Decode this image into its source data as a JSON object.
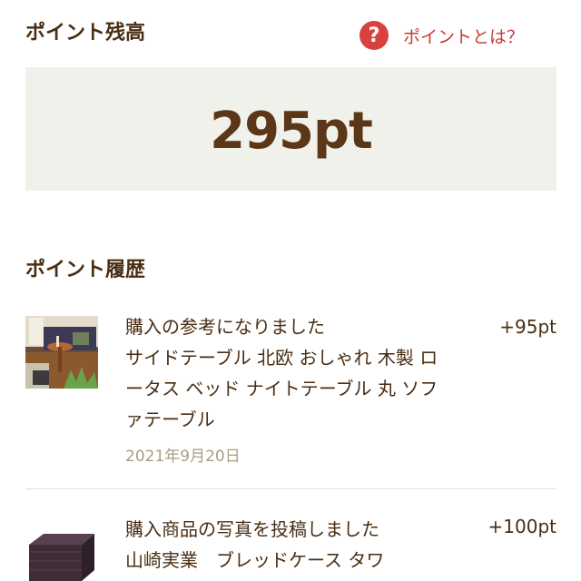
{
  "balance": {
    "title": "ポイント残高",
    "help_label": "ポイントとは？",
    "help_icon": "?",
    "value": "295pt"
  },
  "history": {
    "title": "ポイント履歴",
    "items": [
      {
        "reason": "購入の参考になりました",
        "product": "サイドテーブル 北欧 おしゃれ 木製 ロータス ベッド ナイトテーブル 丸 ソファテーブル",
        "points": "+95pt",
        "date": "2021年9月20日"
      },
      {
        "reason": "購入商品の写真を投稿しました",
        "product": "山崎実業　ブレッドケース タワ",
        "points": "+100pt"
      }
    ]
  }
}
